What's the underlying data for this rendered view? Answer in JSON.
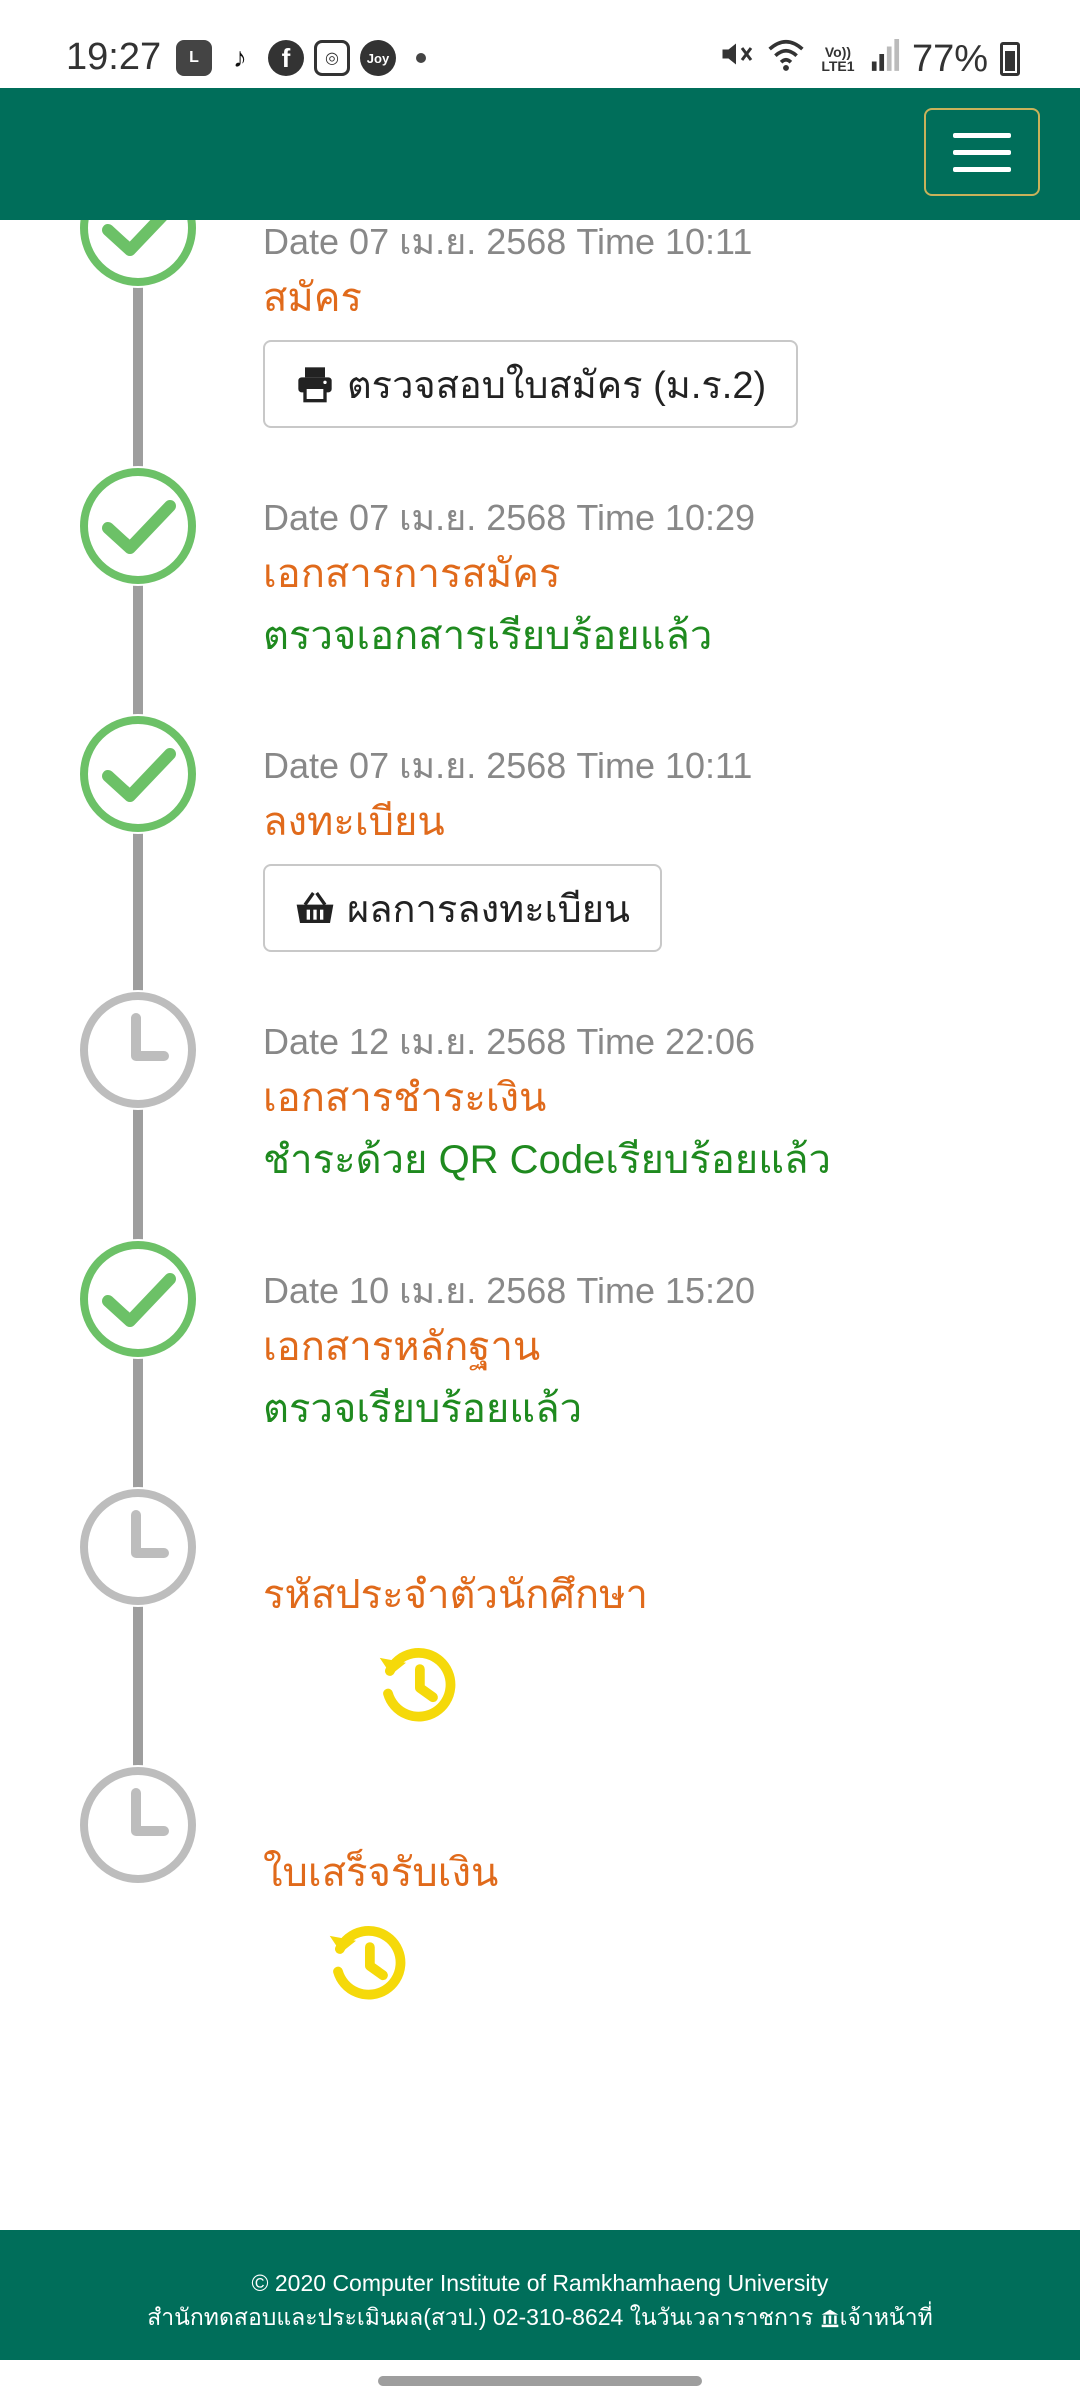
{
  "status_bar": {
    "time": "19:27",
    "network": "Vo)) LTE1",
    "battery": "77%",
    "app_icons": [
      "lemon8-icon",
      "tiktok-icon",
      "facebook-icon",
      "instagram-icon",
      "joy-icon"
    ]
  },
  "navbar": {
    "menu_icon": "hamburger-icon",
    "brand_color": "#006e5a"
  },
  "timeline": [
    {
      "date": "Date 07 เม.ย. 2568 Time 10:11",
      "title": "สมัคร",
      "button": "ตรวจสอบใบสมัคร (ม.ร.2)",
      "button_icon": "printer-icon",
      "state": "done"
    },
    {
      "date": "Date 07 เม.ย. 2568 Time 10:29",
      "title": "เอกสารการสมัคร",
      "status": "ตรวจเอกสารเรียบร้อยแล้ว",
      "state": "done"
    },
    {
      "date": "Date 07 เม.ย. 2568 Time 10:11",
      "title": "ลงทะเบียน",
      "button": "ผลการลงทะเบียน",
      "button_icon": "basket-icon",
      "state": "done"
    },
    {
      "date": "Date 12 เม.ย. 2568 Time 22:06",
      "title": "เอกสารชำระเงิน",
      "status": "ชำระด้วย QR Codeเรียบร้อยแล้ว",
      "state": "pending"
    },
    {
      "date": "Date 10 เม.ย. 2568 Time 15:20",
      "title": "เอกสารหลักฐาน",
      "status": "ตรวจเรียบร้อยแล้ว",
      "state": "done"
    },
    {
      "date": "",
      "title": "รหัสประจำตัวนักศึกษา",
      "state": "pending"
    },
    {
      "date": "",
      "title": "ใบเสร็จรับเงิน",
      "state": "pending"
    }
  ],
  "footer": {
    "line1": "© 2020 Computer Institute of Ramkhamhaeng University",
    "line2": "สำนักทดสอบและประเมินผล(สวป.) 02-310-8624 ในวันเวลาราชการ",
    "staff_link": "เจ้าหน้าที่"
  },
  "colors": {
    "done": "#6cc167",
    "pending": "#bdbdbd",
    "title": "#e06a1b",
    "status": "#1f8a1f",
    "history_icon": "#f5d90a"
  }
}
